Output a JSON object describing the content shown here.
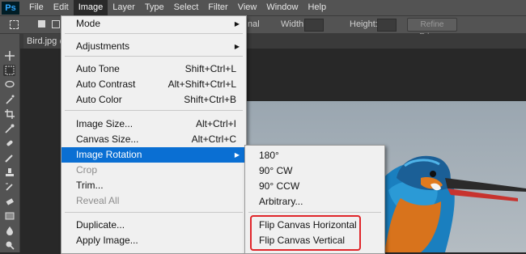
{
  "app": {
    "logo": "Ps"
  },
  "menubar": [
    "File",
    "Edit",
    "Image",
    "Layer",
    "Type",
    "Select",
    "Filter",
    "View",
    "Window",
    "Help"
  ],
  "options_bar": {
    "style_value": "nal",
    "width_label": "Width:",
    "height_label": "Height:",
    "refine_button": "Refine Edge..."
  },
  "document_tab": {
    "label": "Bird.jpg @"
  },
  "image_menu": {
    "items": [
      {
        "label": "Mode",
        "shortcut": "",
        "submenu": true,
        "disabled": false
      },
      {
        "label": "Adjustments",
        "shortcut": "",
        "submenu": true,
        "disabled": false
      },
      {
        "label": "Auto Tone",
        "shortcut": "Shift+Ctrl+L",
        "submenu": false,
        "disabled": false
      },
      {
        "label": "Auto Contrast",
        "shortcut": "Alt+Shift+Ctrl+L",
        "submenu": false,
        "disabled": false
      },
      {
        "label": "Auto Color",
        "shortcut": "Shift+Ctrl+B",
        "submenu": false,
        "disabled": false
      },
      {
        "label": "Image Size...",
        "shortcut": "Alt+Ctrl+I",
        "submenu": false,
        "disabled": false
      },
      {
        "label": "Canvas Size...",
        "shortcut": "Alt+Ctrl+C",
        "submenu": false,
        "disabled": false
      },
      {
        "label": "Image Rotation",
        "shortcut": "",
        "submenu": true,
        "disabled": false,
        "highlighted": true
      },
      {
        "label": "Crop",
        "shortcut": "",
        "submenu": false,
        "disabled": true
      },
      {
        "label": "Trim...",
        "shortcut": "",
        "submenu": false,
        "disabled": false
      },
      {
        "label": "Reveal All",
        "shortcut": "",
        "submenu": false,
        "disabled": true
      },
      {
        "label": "Duplicate...",
        "shortcut": "",
        "submenu": false,
        "disabled": false
      },
      {
        "label": "Apply Image...",
        "shortcut": "",
        "submenu": false,
        "disabled": false
      }
    ]
  },
  "rotation_submenu": {
    "items": [
      "180°",
      "90° CW",
      "90° CCW",
      "Arbitrary...",
      "Flip Canvas Horizontal",
      "Flip Canvas Vertical"
    ]
  },
  "colors": {
    "highlight": "#0a6fd3",
    "annotation_border": "#e0262a",
    "ui_dark": "#535353"
  }
}
